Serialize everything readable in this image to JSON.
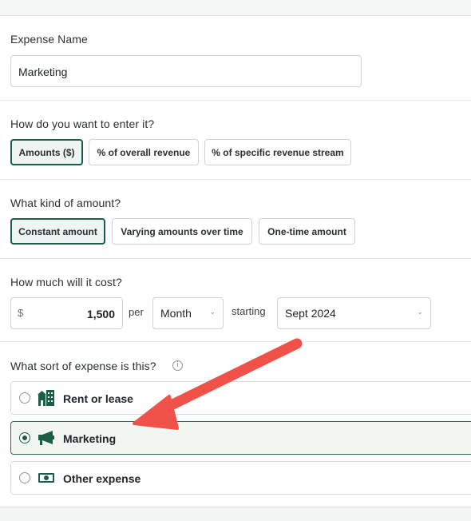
{
  "expense_name": {
    "label": "Expense Name",
    "value": "Marketing"
  },
  "entry_method": {
    "label": "How do you want to enter it?",
    "options": [
      "Amounts ($)",
      "% of overall revenue",
      "% of specific revenue stream"
    ],
    "selected": "Amounts ($)"
  },
  "amount_kind": {
    "label": "What kind of amount?",
    "options": [
      "Constant amount",
      "Varying amounts over time",
      "One-time amount"
    ],
    "selected": "Constant amount"
  },
  "cost": {
    "label": "How much will it cost?",
    "currency_symbol": "$",
    "amount": "1,500",
    "per_label": "per",
    "period": "Month",
    "starting_label": "starting",
    "start_date": "Sept 2024"
  },
  "expense_type": {
    "label": "What sort of expense is this?",
    "info_icon": "info-icon",
    "options": [
      {
        "label": "Rent or lease",
        "icon": "building-icon",
        "selected": false
      },
      {
        "label": "Marketing",
        "icon": "megaphone-icon",
        "selected": true
      },
      {
        "label": "Other expense",
        "icon": "cash-icon",
        "selected": false
      }
    ]
  },
  "colors": {
    "accent_green": "#1b5e45",
    "annotation_arrow": "#f0524a"
  }
}
